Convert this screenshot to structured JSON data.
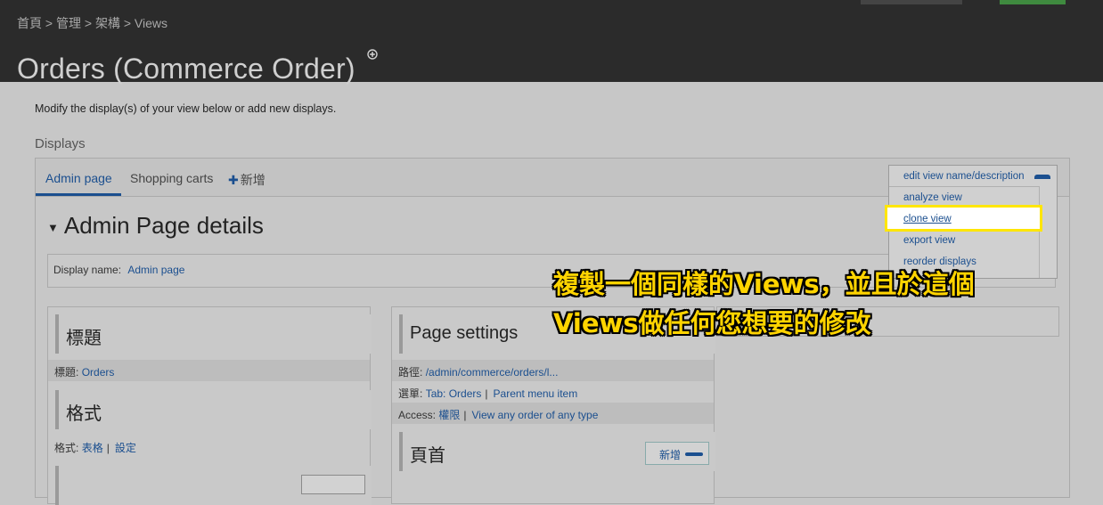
{
  "header": {
    "breadcrumb": [
      "首頁",
      "管理",
      "架構",
      "Views"
    ],
    "breadcrumb_separator": ">",
    "title": "Orders (Commerce Order)",
    "shortcut_icon": "plus-circle-icon"
  },
  "intro": "Modify the display(s) of your view below or add new displays.",
  "displays_heading": "Displays",
  "tabs": {
    "items": [
      "Admin page",
      "Shopping carts"
    ],
    "add_label": "新增",
    "add_icon": "plus-icon",
    "active": "Admin page"
  },
  "details": {
    "title": "Admin Page details",
    "display_name_label": "Display name:",
    "display_name_value": "Admin page"
  },
  "col1": {
    "title_section": "標題",
    "title_label": "標題:",
    "title_value": "Orders",
    "format_section": "格式",
    "format_label": "格式:",
    "format_value": "表格",
    "format_settings": "設定",
    "separator": "|"
  },
  "col2": {
    "section": "Page settings",
    "path_label": "路徑:",
    "path_value": "/admin/commerce/orders/l...",
    "menu_label": "選單:",
    "menu_value": "Tab: Orders",
    "menu_parent": "Parent menu item",
    "access_label": "Access:",
    "access_value": "權限",
    "access_perm": "View any order of any type",
    "header_section": "頁首",
    "header_add": "新增",
    "separator": "|"
  },
  "dropdown": {
    "items": [
      "edit view name/description",
      "analyze view",
      "clone view",
      "export view",
      "reorder displays"
    ],
    "highlighted": "clone view"
  },
  "annotation": {
    "line1": "複製一個同樣的Views，並且於這個",
    "line2": "Views做任何您想要的修改",
    "color": "#ffd400"
  },
  "colors": {
    "link": "#1b4f8f",
    "header_bg": "#2b2b2b",
    "highlight_border": "#ffe600"
  }
}
